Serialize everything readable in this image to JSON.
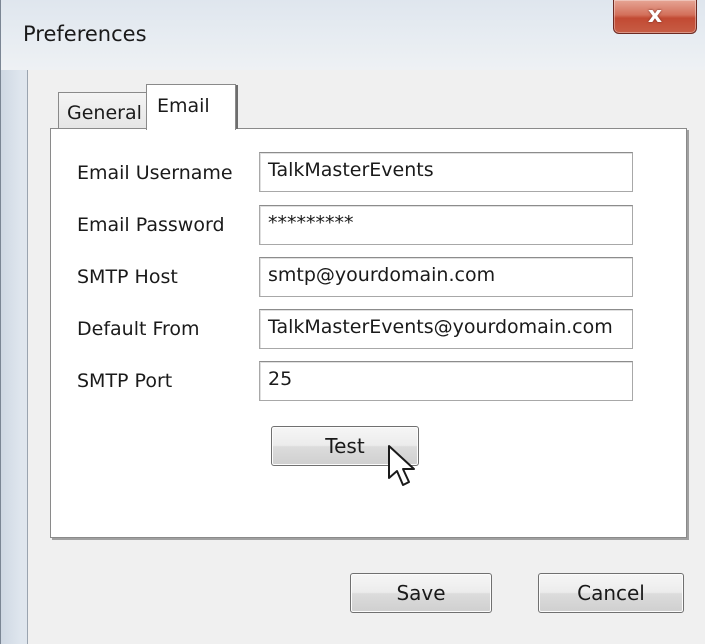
{
  "window": {
    "title": "Preferences",
    "close_glyph": "x"
  },
  "tabs": [
    {
      "label": "General",
      "selected": false
    },
    {
      "label": "Email",
      "selected": true
    }
  ],
  "form": {
    "username": {
      "label": "Email Username",
      "value": "TalkMasterEvents"
    },
    "password": {
      "label": "Email Password",
      "value": "*********"
    },
    "smtp_host": {
      "label": "SMTP Host",
      "value": "smtp@yourdomain.com"
    },
    "default_from": {
      "label": "Default From",
      "value": "TalkMasterEvents@yourdomain.com"
    },
    "smtp_port": {
      "label": "SMTP Port",
      "value": "25"
    }
  },
  "buttons": {
    "test": "Test",
    "save": "Save",
    "cancel": "Cancel"
  },
  "icons": {
    "close": "close-icon",
    "cursor": "pointer-cursor-icon"
  },
  "colors": {
    "close_button": "#c75d45",
    "panel": "#ffffff",
    "dialog_background": "#f0f0f0"
  }
}
